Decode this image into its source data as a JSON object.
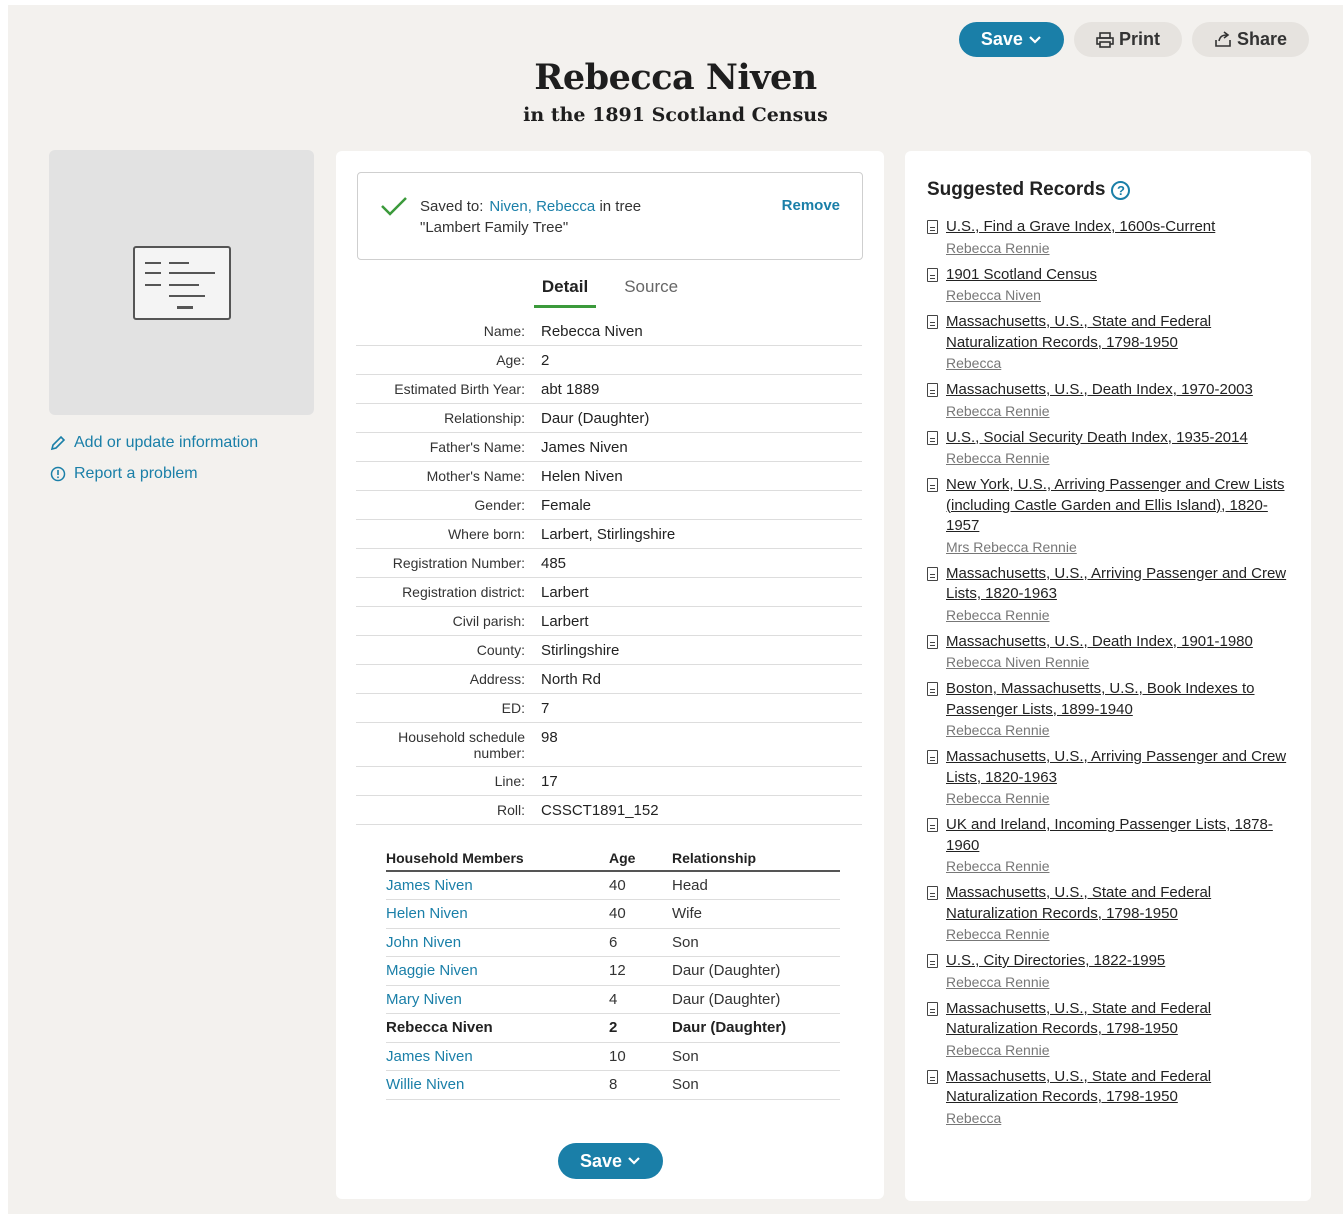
{
  "header": {
    "save_label": "Save",
    "print_label": "Print",
    "share_label": "Share",
    "title": "Rebecca Niven",
    "subtitle": "in the 1891 Scotland Census"
  },
  "left": {
    "add_update": "Add or update information",
    "report": "Report a problem"
  },
  "saved": {
    "label": "Saved to:",
    "person": "Niven, Rebecca",
    "tree_text": "in tree \"Lambert Family Tree\"",
    "remove": "Remove"
  },
  "tabs": [
    "Detail",
    "Source"
  ],
  "detail": [
    {
      "label": "Name:",
      "value": "Rebecca Niven"
    },
    {
      "label": "Age:",
      "value": "2"
    },
    {
      "label": "Estimated Birth Year:",
      "value": "abt 1889"
    },
    {
      "label": "Relationship:",
      "value": "Daur (Daughter)"
    },
    {
      "label": "Father's Name:",
      "value": "James Niven"
    },
    {
      "label": "Mother's Name:",
      "value": "Helen Niven"
    },
    {
      "label": "Gender:",
      "value": "Female"
    },
    {
      "label": "Where born:",
      "value": "Larbert, Stirlingshire"
    },
    {
      "label": "Registration Number:",
      "value": "485"
    },
    {
      "label": "Registration district:",
      "value": "Larbert"
    },
    {
      "label": "Civil parish:",
      "value": "Larbert"
    },
    {
      "label": "County:",
      "value": "Stirlingshire"
    },
    {
      "label": "Address:",
      "value": "North Rd"
    },
    {
      "label": "ED:",
      "value": "7"
    },
    {
      "label": "Household schedule number:",
      "value": "98"
    },
    {
      "label": "Line:",
      "value": "17"
    },
    {
      "label": "Roll:",
      "value": "CSSCT1891_152"
    }
  ],
  "household": {
    "headers": [
      "Household Members",
      "Age",
      "Relationship"
    ],
    "rows": [
      {
        "name": "James Niven",
        "age": "40",
        "rel": "Head",
        "self": false
      },
      {
        "name": "Helen Niven",
        "age": "40",
        "rel": "Wife",
        "self": false
      },
      {
        "name": "John Niven",
        "age": "6",
        "rel": "Son",
        "self": false
      },
      {
        "name": "Maggie Niven",
        "age": "12",
        "rel": "Daur (Daughter)",
        "self": false
      },
      {
        "name": "Mary Niven",
        "age": "4",
        "rel": "Daur (Daughter)",
        "self": false
      },
      {
        "name": "Rebecca Niven",
        "age": "2",
        "rel": "Daur (Daughter)",
        "self": true
      },
      {
        "name": "James Niven",
        "age": "10",
        "rel": "Son",
        "self": false
      },
      {
        "name": "Willie Niven",
        "age": "8",
        "rel": "Son",
        "self": false
      }
    ]
  },
  "suggested": {
    "title": "Suggested Records",
    "records": [
      {
        "title": "U.S., Find a Grave Index, 1600s-Current",
        "name": "Rebecca Rennie"
      },
      {
        "title": "1901 Scotland Census",
        "name": "Rebecca Niven"
      },
      {
        "title": "Massachusetts, U.S., State and Federal Naturalization Records, 1798-1950",
        "name": "Rebecca"
      },
      {
        "title": "Massachusetts, U.S., Death Index, 1970-2003",
        "name": "Rebecca Rennie"
      },
      {
        "title": "U.S., Social Security Death Index, 1935-2014",
        "name": "Rebecca Rennie"
      },
      {
        "title": "New York, U.S., Arriving Passenger and Crew Lists (including Castle Garden and Ellis Island), 1820-1957",
        "name": "Mrs Rebecca Rennie"
      },
      {
        "title": "Massachusetts, U.S., Arriving Passenger and Crew Lists, 1820-1963",
        "name": "Rebecca Rennie"
      },
      {
        "title": "Massachusetts, U.S., Death Index, 1901-1980",
        "name": "Rebecca Niven Rennie"
      },
      {
        "title": "Boston, Massachusetts, U.S., Book Indexes to Passenger Lists, 1899-1940",
        "name": "Rebecca Rennie"
      },
      {
        "title": "Massachusetts, U.S., Arriving Passenger and Crew Lists, 1820-1963",
        "name": "Rebecca Rennie"
      },
      {
        "title": "UK and Ireland, Incoming Passenger Lists, 1878-1960",
        "name": "Rebecca Rennie"
      },
      {
        "title": "Massachusetts, U.S., State and Federal Naturalization Records, 1798-1950",
        "name": "Rebecca Rennie"
      },
      {
        "title": "U.S., City Directories, 1822-1995",
        "name": "Rebecca Rennie"
      },
      {
        "title": "Massachusetts, U.S., State and Federal Naturalization Records, 1798-1950",
        "name": "Rebecca Rennie"
      },
      {
        "title": "Massachusetts, U.S., State and Federal Naturalization Records, 1798-1950",
        "name": "Rebecca"
      }
    ]
  },
  "colors": {
    "accent": "#1a7fa8",
    "check": "#3b9a3b",
    "background": "#f3f1ee"
  }
}
